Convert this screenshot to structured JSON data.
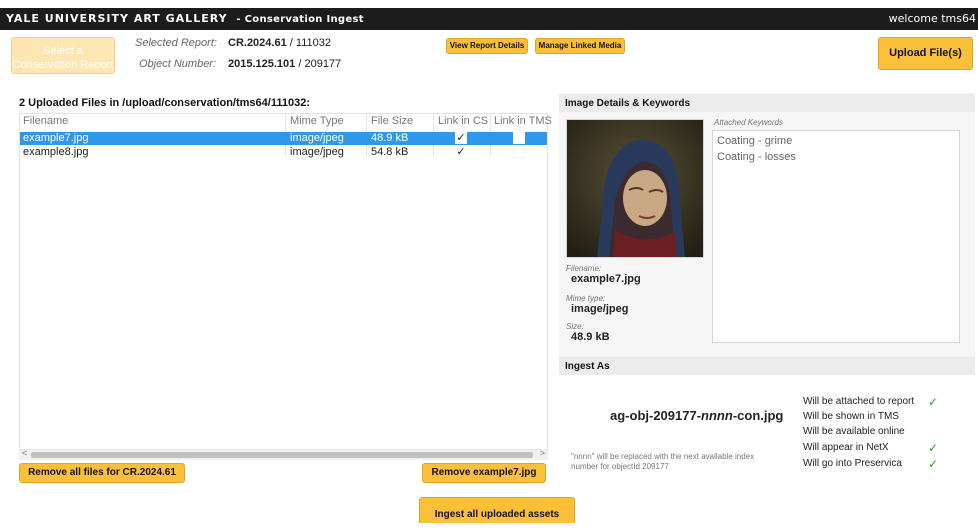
{
  "header": {
    "brand": "YALE UNIVERSITY ART GALLERY",
    "subtitle": "- Conservation Ingest",
    "welcome": "welcome tms64"
  },
  "report": {
    "select_button": "Select a Conservation Report",
    "selected_report_label": "Selected Report:",
    "selected_report_id": "CR.2024.61",
    "selected_report_num": "/ 111032",
    "object_number_label": "Object Number:",
    "object_number": "2015.125.101",
    "object_id": "/ 209177",
    "view_details_button": "View Report Details",
    "manage_media_button": "Manage Linked Media",
    "upload_button": "Upload File(s)"
  },
  "files": {
    "title": "2 Uploaded Files in /upload/conservation/tms64/111032:",
    "columns": [
      "Filename",
      "Mime Type",
      "File Size",
      "Link in CS",
      "Link in TMS"
    ],
    "rows": [
      {
        "filename": "example7.jpg",
        "mime": "image/jpeg",
        "size": "48.9 kB",
        "link_cs": "✓",
        "link_tms": ""
      },
      {
        "filename": "example8.jpg",
        "mime": "image/jpeg",
        "size": "54.8 kB",
        "link_cs": "✓",
        "link_tms": ""
      }
    ],
    "remove_all_button": "Remove all files for CR.2024.61",
    "remove_selected_button": "Remove example7.jpg"
  },
  "details": {
    "title": "Image Details & Keywords",
    "keywords_label": "Attached Keywords",
    "keywords": [
      "Coating - grime",
      "Coating - losses"
    ],
    "filename_label": "Filename:",
    "filename": "example7.jpg",
    "mime_label": "Mime type:",
    "mime": "image/jpeg",
    "size_label": "Size:",
    "size": "48.9 kB"
  },
  "ingest": {
    "title": "Ingest As",
    "name_prefix": "ag-obj-209177-",
    "name_placeholder": "nnnn",
    "name_suffix": "-con.jpg",
    "note": "\"nnnn\" will be replaced with the next available index number for objectId 209177",
    "statuses": [
      {
        "text": "Will be attached to report",
        "check": "✓"
      },
      {
        "text": "Will be shown in TMS",
        "check": ""
      },
      {
        "text": "Will be available online",
        "check": ""
      },
      {
        "text": "Will appear in NetX",
        "check": "✓"
      },
      {
        "text": "Will go into Preservica",
        "check": "✓"
      }
    ],
    "ingest_all_button": "Ingest all uploaded assets"
  }
}
